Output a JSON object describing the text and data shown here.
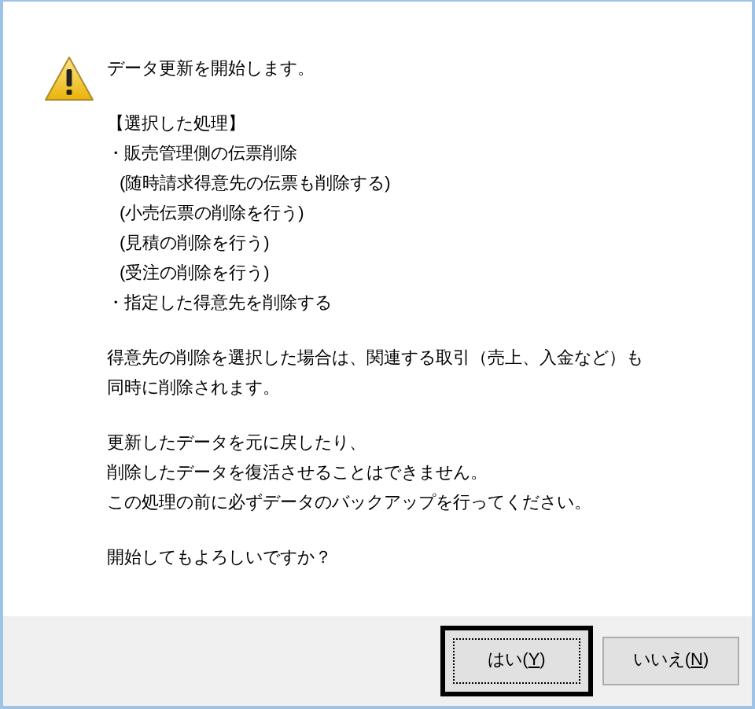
{
  "dialog": {
    "title_line": "データ更新を開始します。",
    "selection": {
      "heading": "【選択した処理】",
      "items": [
        {
          "text": "・販売管理側の伝票削除",
          "children": [
            {
              "text": "(随時請求得意先の伝票も削除する)"
            },
            {
              "text": "(小売伝票の削除を行う)"
            },
            {
              "text": "(見積の削除を行う)"
            },
            {
              "text": "(受注の削除を行う)"
            }
          ]
        },
        {
          "text": "・指定した得意先を削除する"
        }
      ]
    },
    "paragraphs": [
      [
        "得意先の削除を選択した場合は、関連する取引（売上、入金など）も",
        "同時に削除されます。"
      ],
      [
        "更新したデータを元に戻したり、",
        "削除したデータを復活させることはできません。",
        "この処理の前に必ずデータのバックアップを行ってください。"
      ],
      [
        "開始してもよろしいですか？"
      ]
    ],
    "buttons": [
      {
        "before": "はい(",
        "mnemonic": "Y",
        "after": ")",
        "default": true
      },
      {
        "before": "いいえ(",
        "mnemonic": "N",
        "after": ")",
        "default": false
      }
    ]
  }
}
